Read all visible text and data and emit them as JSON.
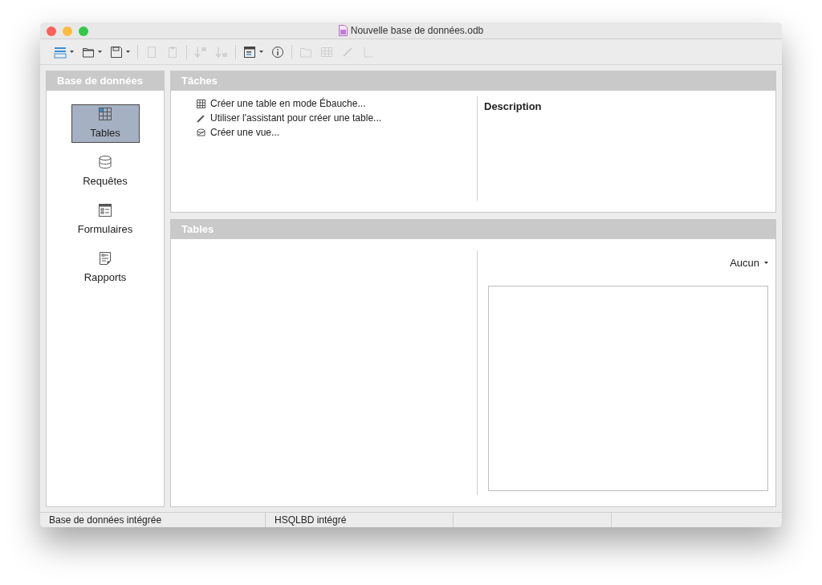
{
  "window": {
    "title": "Nouvelle base de données.odb"
  },
  "toolbar": [
    {
      "dropdown": true,
      "disabled": false
    },
    {
      "dropdown": true,
      "disabled": false
    },
    {
      "dropdown": true,
      "disabled": false
    },
    {
      "dropdown": false,
      "disabled": true
    },
    {
      "dropdown": false,
      "disabled": true
    },
    {
      "dropdown": false,
      "disabled": true
    },
    {
      "dropdown": false,
      "disabled": true
    },
    {
      "dropdown": true,
      "disabled": false
    },
    {
      "dropdown": false,
      "disabled": false
    },
    {
      "dropdown": false,
      "disabled": true
    },
    {
      "dropdown": false,
      "disabled": true
    },
    {
      "dropdown": false,
      "disabled": true
    },
    {
      "dropdown": false,
      "disabled": true
    }
  ],
  "sidebar": {
    "title": "Base de données",
    "items": [
      {
        "label": "Tables",
        "selected": true
      },
      {
        "label": "Requêtes",
        "selected": false
      },
      {
        "label": "Formulaires",
        "selected": false
      },
      {
        "label": "Rapports",
        "selected": false
      }
    ]
  },
  "tasks": {
    "title": "Tâches",
    "items": [
      "Créer une table en mode Ébauche...",
      "Utiliser l'assistant pour créer une table...",
      "Créer une vue..."
    ],
    "description_title": "Description"
  },
  "tables": {
    "title": "Tables",
    "preview_mode": "Aucun"
  },
  "status_bar": [
    "Base de données intégrée",
    "HSQLBD intégré"
  ]
}
